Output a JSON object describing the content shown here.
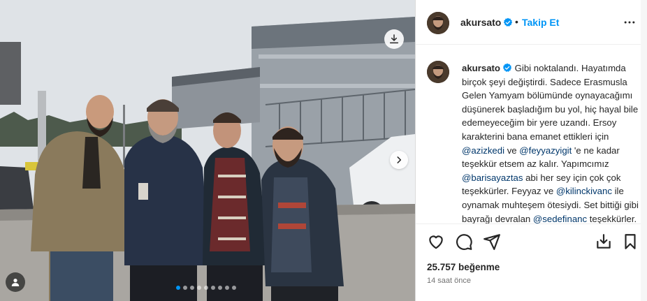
{
  "post": {
    "username": "akursato",
    "separator": "•",
    "follow_label": "Takip Et",
    "caption_parts": [
      {
        "t": "Gibi noktalandı. Hayatımda birçok şeyi değiştirdi. Sadece Erasmusla Gelen Yamyam bölümünde oynayacağımı düşünerek başladığım bu yol, hiç hayal bile edemeyeceğim bir yere uzandı. Ersoy karakterini bana emanet ettikleri için ",
        "mention": false
      },
      {
        "t": "@azizkedi",
        "mention": true
      },
      {
        "t": " ve ",
        "mention": false
      },
      {
        "t": "@feyyazyigit",
        "mention": true
      },
      {
        "t": " 'e ne kadar teşekkür etsem az kalır. Yapımcımız ",
        "mention": false
      },
      {
        "t": "@barisayaztas",
        "mention": true
      },
      {
        "t": " abi her sey için çok çok teşekkürler. Feyyaz ve ",
        "mention": false
      },
      {
        "t": "@kilinckivanc",
        "mention": true
      },
      {
        "t": " ile oynamak muhteşem ötesiydi. Set bittiği gibi bayrağı devralan ",
        "mention": false
      },
      {
        "t": "@sedefinanc",
        "mention": true
      },
      {
        "t": " teşekkürler. Kısaca dümdüz",
        "mention": false
      }
    ],
    "likes": "25.757 beğenme",
    "timestamp": "14 saat önce",
    "carousel": {
      "count": 9,
      "active_index": 0
    }
  },
  "icons": {
    "verified": "verified-badge-icon",
    "more": "more-options-icon",
    "like": "heart-icon",
    "comment": "comment-icon",
    "share": "share-icon",
    "download": "download-icon",
    "save": "bookmark-icon",
    "next": "chevron-right-icon",
    "tagged": "user-tag-icon"
  },
  "colors": {
    "accent": "#0095f6",
    "text": "#262626",
    "mention": "#00376b",
    "secondary": "#737373"
  }
}
